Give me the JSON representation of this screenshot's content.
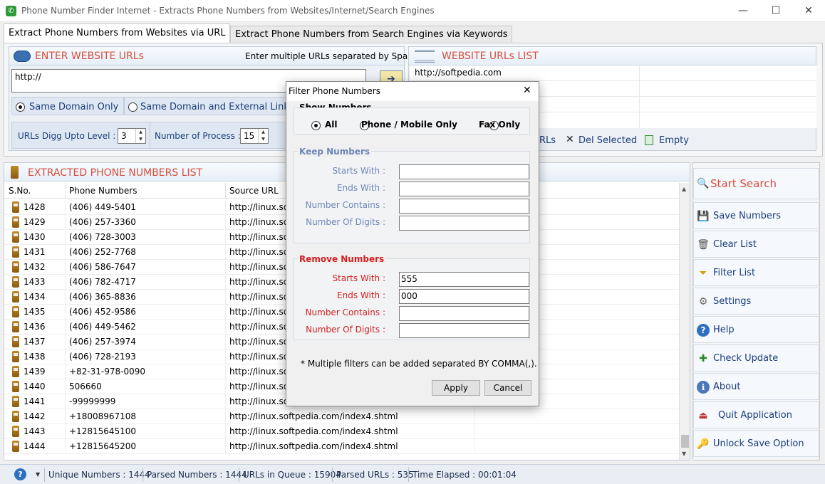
{
  "window": {
    "title": "Phone Number Finder Internet - Extracts Phone Numbers from Websites/Internet/Search Engines",
    "min": "—",
    "max": "☐",
    "close": "✕"
  },
  "tabs": [
    {
      "label": "Extract Phone Numbers from Websites via URL"
    },
    {
      "label": "Extract Phone Numbers from Search Engines via Keywords"
    }
  ],
  "enter_urls": {
    "title": "ENTER WEBSITE URLs",
    "hint": "Enter multiple URLs separated by Spaces",
    "value": "http://",
    "go": "➔"
  },
  "domain_options": [
    {
      "label": "Same Domain Only",
      "selected": true
    },
    {
      "label": "Same Domain and External Link",
      "selected": false
    }
  ],
  "digg": {
    "label": "URLs Digg Upto Level :",
    "value": "3"
  },
  "process": {
    "label": "Number of Process :",
    "value": "15"
  },
  "website_list": {
    "title": "WEBSITE URLs LIST",
    "items": [
      "http://softpedia.com"
    ],
    "rls_label": "RLs",
    "del_selected": "Del Selected",
    "empty": "Empty"
  },
  "extracted": {
    "title": "EXTRACTED PHONE NUMBERS LIST",
    "headers": [
      "S.No.",
      "Phone Numbers",
      "Source URL"
    ],
    "rows": [
      [
        "1428",
        "(406) 449-5401",
        "http://linux.so"
      ],
      [
        "1429",
        "(406) 257-3360",
        "http://linux.so"
      ],
      [
        "1430",
        "(406) 728-3003",
        "http://linux.so"
      ],
      [
        "1431",
        "(406) 252-7768",
        "http://linux.so"
      ],
      [
        "1432",
        "(406) 586-7647",
        "http://linux.so"
      ],
      [
        "1433",
        "(406) 782-4717",
        "http://linux.so"
      ],
      [
        "1434",
        "(406) 365-8836",
        "http://linux.so"
      ],
      [
        "1435",
        "(406) 452-9586",
        "http://linux.so"
      ],
      [
        "1436",
        "(406) 449-5462",
        "http://linux.so"
      ],
      [
        "1437",
        "(406) 257-3974",
        "http://linux.so"
      ],
      [
        "1438",
        "(406) 728-2193",
        "http://linux.so"
      ],
      [
        "1439",
        "+82-31-978-0090",
        "http://linux.so"
      ],
      [
        "1440",
        "506660",
        "http://linux.so"
      ],
      [
        "1441",
        "-99999999",
        "http://linux.so"
      ],
      [
        "1442",
        "+18008967108",
        "http://linux.softpedia.com/index4.shtml"
      ],
      [
        "1443",
        "+12815645100",
        "http://linux.softpedia.com/index4.shtml"
      ],
      [
        "1444",
        "+12815645200",
        "http://linux.softpedia.com/index4.shtml"
      ]
    ]
  },
  "sidebar": [
    {
      "label": "Start Search",
      "icon": "🔍"
    },
    {
      "label": "Save Numbers",
      "icon": "💾"
    },
    {
      "label": "Clear List",
      "icon": "🗑"
    },
    {
      "label": "Filter List",
      "icon": "⏷"
    },
    {
      "label": "Settings",
      "icon": "⚙"
    },
    {
      "label": "Help",
      "icon": "?"
    },
    {
      "label": "Check Update",
      "icon": "✚"
    },
    {
      "label": "About",
      "icon": "ℹ"
    },
    {
      "label": "Quit Application",
      "icon": "⏏"
    },
    {
      "label": "Unlock Save Option",
      "icon": "🔑"
    }
  ],
  "status": {
    "help": "?",
    "unique": "Unique Numbers :  1444",
    "parsed": "Parsed Numbers :  1444",
    "queue": "URLs in Queue :  15904",
    "parsed_urls": "Parsed URLs :  535",
    "elapsed": "Time Elapsed :  00:01:04"
  },
  "dialog": {
    "title": "Filter Phone Numbers",
    "close": "✕",
    "show_title": "Show Numbers",
    "show_options": [
      {
        "label": "All",
        "selected": true
      },
      {
        "label": "Phone / Mobile Only",
        "selected": false
      },
      {
        "label": "Fax Only",
        "selected": false
      }
    ],
    "keep_title": "Keep Numbers",
    "keep_fields": [
      {
        "label": "Starts With :",
        "value": ""
      },
      {
        "label": "Ends With :",
        "value": ""
      },
      {
        "label": "Number Contains :",
        "value": ""
      },
      {
        "label": "Number Of Digits :",
        "value": ""
      }
    ],
    "remove_title": "Remove Numbers",
    "remove_fields": [
      {
        "label": "Starts With :",
        "value": "555"
      },
      {
        "label": "Ends With :",
        "value": "000"
      },
      {
        "label": "Number Contains :",
        "value": ""
      },
      {
        "label": "Number Of Digits :",
        "value": ""
      }
    ],
    "note": "* Multiple filters can be added separated BY COMMA(,).",
    "apply": "Apply",
    "cancel": "Cancel"
  }
}
